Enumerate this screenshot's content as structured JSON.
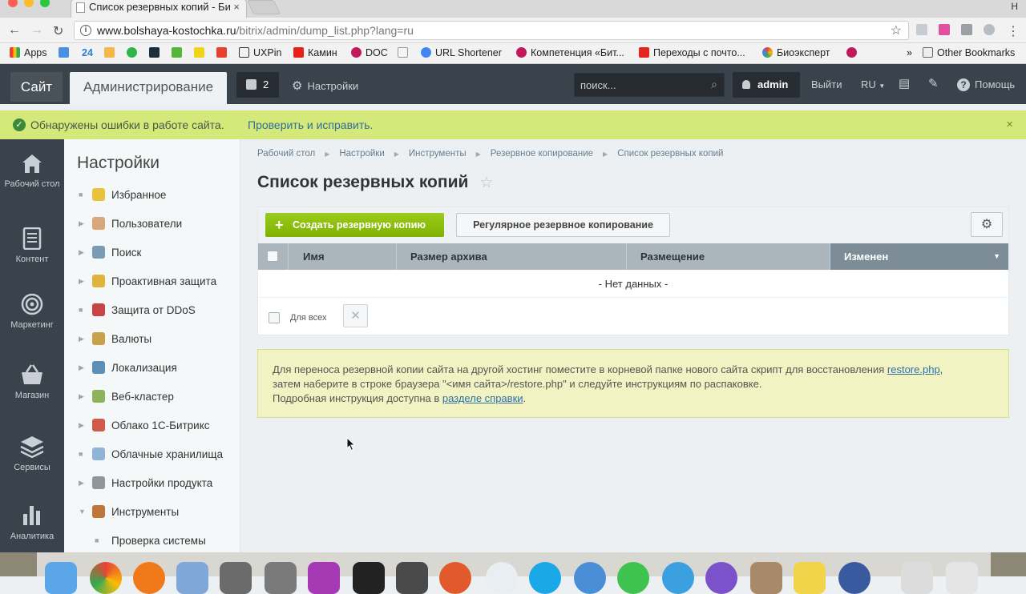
{
  "browser": {
    "tab_title": "Список резервных копий - Би",
    "tab_close": "×",
    "profile_letter": "Н",
    "url_host": "www.bolshaya-kostochka.ru",
    "url_path": "/bitrix/admin/dump_list.php?lang=ru",
    "bookmarks": [
      "Apps",
      "24",
      "UXPin",
      "Камин",
      "DOC",
      "URL Shortener",
      "Компетенция «Бит...",
      "Переходы с почто...",
      "Биоэксперт",
      "Other Bookmarks"
    ],
    "bookmarks_more": "»"
  },
  "header": {
    "site_label": "Сайт",
    "admin_label": "Администрирование",
    "notifications_count": "2",
    "settings_label": "Настройки",
    "search_placeholder": "поиск...",
    "user_name": "admin",
    "logout_label": "Выйти",
    "lang_label": "RU",
    "help_label": "Помощь"
  },
  "error_notice": {
    "text": "Обнаружены ошибки в работе сайта.",
    "link": "Проверить и исправить.",
    "close": "×"
  },
  "rail": [
    {
      "label": "Рабочий стол",
      "icon": "home-icon"
    },
    {
      "label": "Контент",
      "icon": "document-icon"
    },
    {
      "label": "Маркетинг",
      "icon": "target-icon"
    },
    {
      "label": "Магазин",
      "icon": "basket-icon"
    },
    {
      "label": "Сервисы",
      "icon": "layers-icon"
    },
    {
      "label": "Аналитика",
      "icon": "bar-chart-icon"
    }
  ],
  "menu": {
    "title": "Настройки",
    "items": [
      {
        "label": "Избранное",
        "marker": "■",
        "icon": "star-icon",
        "color": "#e9c23c"
      },
      {
        "label": "Пользователи",
        "marker": "▶",
        "icon": "user-icon",
        "color": "#d9a77a"
      },
      {
        "label": "Поиск",
        "marker": "▶",
        "icon": "search-icon",
        "color": "#7a9bb5"
      },
      {
        "label": "Проактивная защита",
        "marker": "▶",
        "icon": "lock-icon",
        "color": "#e0b43a"
      },
      {
        "label": "Защита от DDoS",
        "marker": "■",
        "icon": "shield-icon",
        "color": "#c94444"
      },
      {
        "label": "Валюты",
        "marker": "▶",
        "icon": "coin-icon",
        "color": "#c9a14a"
      },
      {
        "label": "Локализация",
        "marker": "▶",
        "icon": "globe-icon",
        "color": "#5c8fb8"
      },
      {
        "label": "Веб-кластер",
        "marker": "▶",
        "icon": "cluster-icon",
        "color": "#8fb35c"
      },
      {
        "label": "Облако 1С-Битрикс",
        "marker": "▶",
        "icon": "cloud-icon",
        "color": "#d35a4a"
      },
      {
        "label": "Облачные хранилища",
        "marker": "■",
        "icon": "storage-icon",
        "color": "#8fb4d8"
      },
      {
        "label": "Настройки продукта",
        "marker": "▶",
        "icon": "gear-icon",
        "color": "#8e979d"
      },
      {
        "label": "Инструменты",
        "marker": "▼",
        "icon": "tools-icon",
        "color": "#c0763a"
      },
      {
        "label": "Проверка системы",
        "marker": "■",
        "icon": "",
        "color": ""
      }
    ]
  },
  "breadcrumbs": [
    "Рабочий стол",
    "Настройки",
    "Инструменты",
    "Резервное копирование",
    "Список резервных копий"
  ],
  "page_title": "Список резервных копий",
  "toolbar": {
    "create_label": "Создать резервную копию",
    "regular_label": "Регулярное резервное копирование"
  },
  "table": {
    "columns": [
      "Имя",
      "Размер архива",
      "Размещение",
      "Изменен"
    ],
    "sorted_column": "Изменен",
    "empty_text": "- Нет данных -",
    "for_all_label": "Для всех"
  },
  "info": {
    "line1_pre": "Для переноса резервной копии сайта на другой хостинг поместите в корневой папке нового сайта скрипт для восстановления ",
    "line1_link": "restore.php",
    "line1_post": ",",
    "line2": "затем наберите в строке браузера \"<имя сайта>/restore.php\" и следуйте инструкциям по распаковке.",
    "line3_pre": "Подробная инструкция доступна в ",
    "line3_link": "разделе справки",
    "line3_post": "."
  },
  "colors": {
    "accent_green": "#86ad00",
    "header_dark": "#3a424b",
    "notice_green": "#d5e97a",
    "info_yellow": "#f1f3c2",
    "link_blue": "#2f6fa5"
  }
}
